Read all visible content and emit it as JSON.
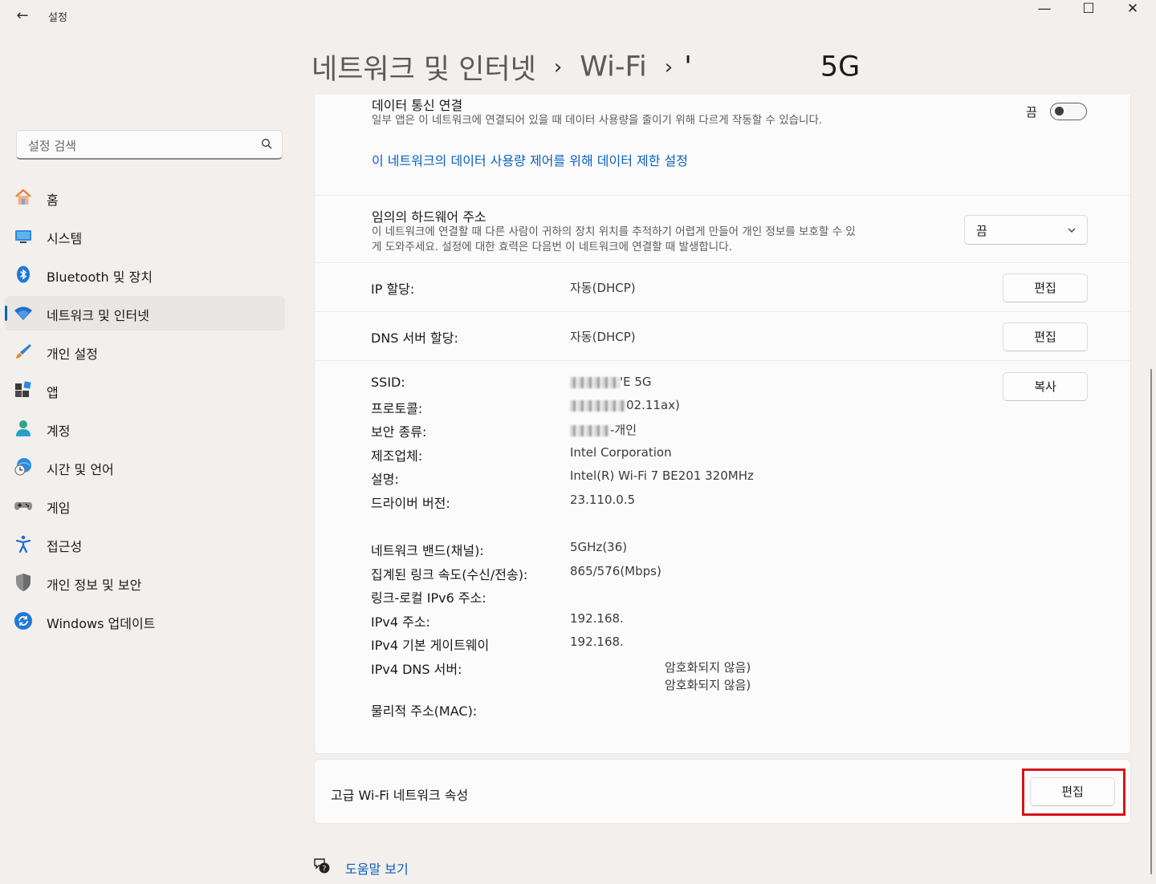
{
  "window": {
    "title": "설정",
    "back_glyph": "←",
    "minimize_glyph": "—",
    "maximize_glyph": "☐",
    "close_glyph": "✕"
  },
  "search": {
    "placeholder": "설정 검색"
  },
  "sidebar": {
    "items": [
      {
        "label": "홈",
        "icon": "home-icon"
      },
      {
        "label": "시스템",
        "icon": "system-icon"
      },
      {
        "label": "Bluetooth 및 장치",
        "icon": "bluetooth-icon"
      },
      {
        "label": "네트워크 및 인터넷",
        "icon": "wifi-icon",
        "active": true
      },
      {
        "label": "개인 설정",
        "icon": "brush-icon"
      },
      {
        "label": "앱",
        "icon": "apps-icon"
      },
      {
        "label": "계정",
        "icon": "account-icon"
      },
      {
        "label": "시간 및 언어",
        "icon": "time-language-icon"
      },
      {
        "label": "게임",
        "icon": "gamepad-icon"
      },
      {
        "label": "접근성",
        "icon": "accessibility-icon"
      },
      {
        "label": "개인 정보 및 보안",
        "icon": "shield-icon"
      },
      {
        "label": "Windows 업데이트",
        "icon": "update-icon"
      }
    ]
  },
  "breadcrumb": {
    "level1": "네트워크 및 인터넷",
    "level2": "Wi-Fi",
    "level3_prefix": "'",
    "level3_suffix": "5G",
    "separator": "›"
  },
  "metered": {
    "title": "데이터 통신 연결",
    "description": "일부 앱은 이 네트워크에 연결되어 있을 때 데이터 사용량을 줄이기 위해 다르게 작동할 수 있습니다.",
    "state_label": "끔",
    "link": "이 네트워크의 데이터 사용량 제어를 위해 데이터 제한 설정"
  },
  "random_mac": {
    "title": "임의의 하드웨어 주소",
    "description_line1": "이 네트워크에 연결할 때 다른 사람이 귀하의 장치 위치를 추적하기 어렵게 만들어 개인 정보를 보호할 수 있",
    "description_line2": "게 도와주세요. 설정에 대한 효력은 다음번 이 네트워크에 연결할 때 발생합니다.",
    "selected": "끔"
  },
  "ip_assignment": {
    "label": "IP 할당:",
    "value": "자동(DHCP)",
    "button": "편집"
  },
  "dns_assignment": {
    "label": "DNS 서버 할당:",
    "value": "자동(DHCP)",
    "button": "편집"
  },
  "properties": {
    "copy_button": "복사",
    "ssid": {
      "label": "SSID:",
      "value": "'E 5G"
    },
    "protocol": {
      "label": "프로토콜:",
      "value": "02.11ax)"
    },
    "security": {
      "label": "보안 종류:",
      "value": "-개인"
    },
    "manufacturer": {
      "label": "제조업체:",
      "value": "Intel Corporation"
    },
    "description": {
      "label": "설명:",
      "value": "Intel(R) Wi-Fi 7 BE201 320MHz"
    },
    "driver": {
      "label": "드라이버 버전:",
      "value": "23.110.0.5"
    },
    "band": {
      "label": "네트워크 밴드(채널):",
      "value": "5GHz(36)"
    },
    "link_speed": {
      "label": "집계된 링크 속도(수신/전송):",
      "value": "865/576(Mbps)"
    },
    "ipv6_local": {
      "label": "링크-로컬 IPv6 주소:",
      "value": ""
    },
    "ipv4": {
      "label": "IPv4 주소:",
      "value": "192.168."
    },
    "ipv4_gateway": {
      "label": "IPv4 기본 게이트웨이",
      "value": "192.168."
    },
    "ipv4_dns": {
      "label": "IPv4 DNS 서버:",
      "value1": "암호화되지 않음)",
      "value2": "암호화되지 않음)"
    },
    "mac": {
      "label": "물리적 주소(MAC):",
      "value": ""
    }
  },
  "advanced": {
    "label": "고급 Wi-Fi 네트워크 속성",
    "button": "편집"
  },
  "help": {
    "label": "도움말 보기"
  },
  "colors": {
    "accent": "#0067c0",
    "link": "#0a5ec0",
    "highlight": "#d7141a"
  }
}
